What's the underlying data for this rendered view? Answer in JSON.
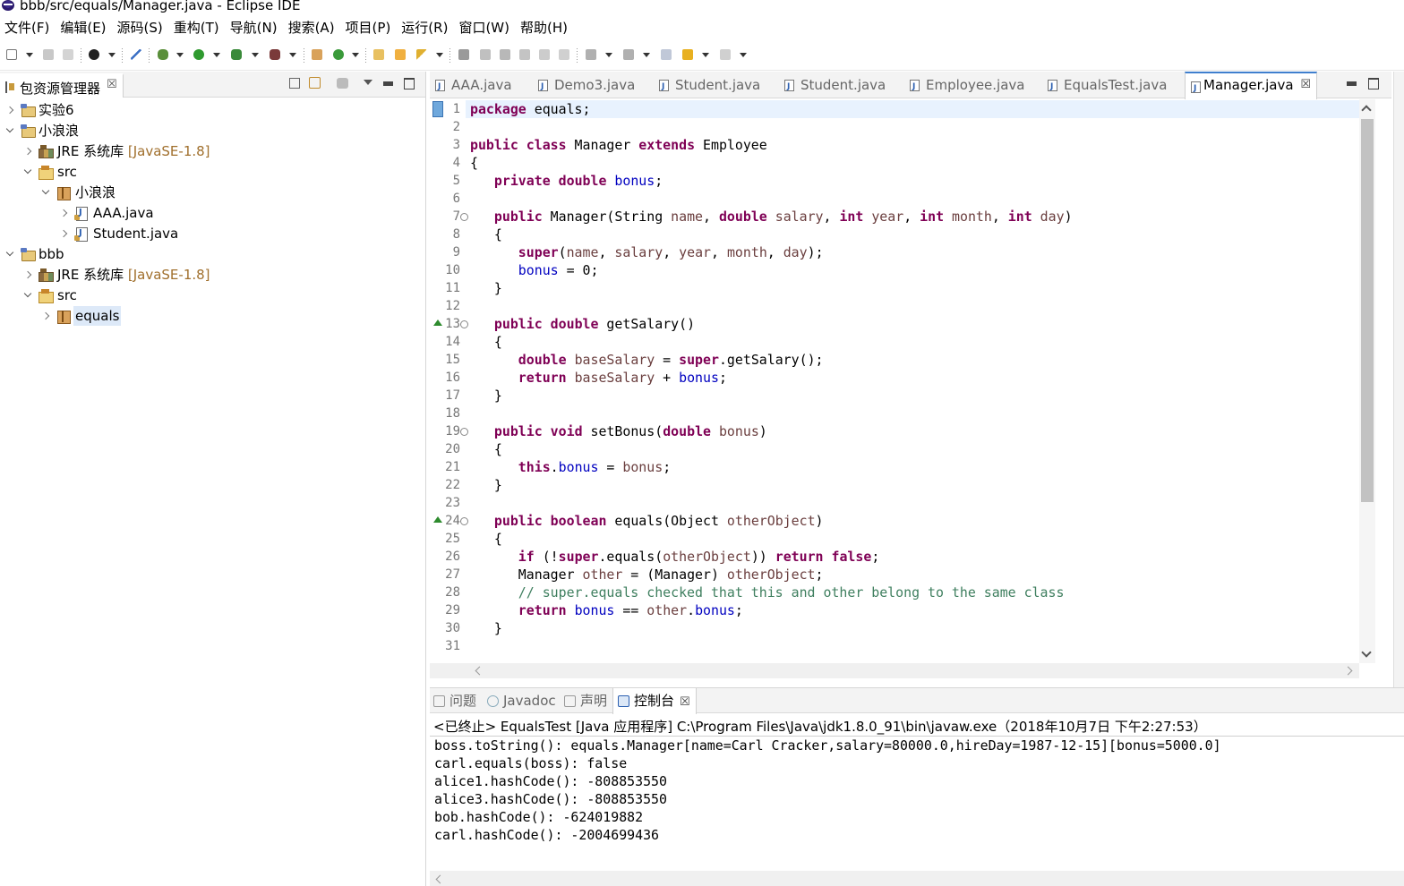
{
  "window": {
    "title": "bbb/src/equals/Manager.java - Eclipse IDE"
  },
  "menu": [
    "文件(F)",
    "编辑(E)",
    "源码(S)",
    "重构(T)",
    "导航(N)",
    "搜索(A)",
    "项目(P)",
    "运行(R)",
    "窗口(W)",
    "帮助(H)"
  ],
  "package_explorer": {
    "tab_label": "包资源管理器",
    "tree": [
      {
        "label": "实验6",
        "deco": ""
      },
      {
        "label": "小浪浪",
        "deco": ""
      },
      {
        "label": "JRE 系统库",
        "deco": "[JavaSE-1.8]"
      },
      {
        "label": "src",
        "deco": ""
      },
      {
        "label": "小浪浪",
        "deco": ""
      },
      {
        "label": "AAA.java",
        "deco": ""
      },
      {
        "label": "Student.java",
        "deco": ""
      },
      {
        "label": "bbb",
        "deco": ""
      },
      {
        "label": "JRE 系统库",
        "deco": "[JavaSE-1.8]"
      },
      {
        "label": "src",
        "deco": ""
      },
      {
        "label": "equals",
        "deco": ""
      }
    ]
  },
  "editor": {
    "tabs": [
      "AAA.java",
      "Demo3.java",
      "Student.java",
      "Student.java",
      "Employee.java",
      "EqualsTest.java",
      "Manager.java"
    ],
    "active_tab": "Manager.java",
    "lines": [
      "package equals;",
      "",
      "public class Manager extends Employee",
      "{",
      "   private double bonus;",
      "",
      "   public Manager(String name, double salary, int year, int month, int day)",
      "   {",
      "      super(name, salary, year, month, day);",
      "      bonus = 0;",
      "   }",
      "",
      "   public double getSalary()",
      "   {",
      "      double baseSalary = super.getSalary();",
      "      return baseSalary + bonus;",
      "   }",
      "",
      "   public void setBonus(double bonus)",
      "   {",
      "      this.bonus = bonus;",
      "   }",
      "",
      "   public boolean equals(Object otherObject)",
      "   {",
      "      if (!super.equals(otherObject)) return false;",
      "      Manager other = (Manager) otherObject;",
      "      // super.equals checked that this and other belong to the same class",
      "      return bonus == other.bonus;",
      "   }",
      ""
    ]
  },
  "bottom_panel": {
    "tabs": [
      "问题",
      "Javadoc",
      "声明",
      "控制台"
    ],
    "active_tab": "控制台",
    "console_header": "<已终止> EqualsTest [Java 应用程序] C:\\Program Files\\Java\\jdk1.8.0_91\\bin\\javaw.exe（2018年10月7日 下午2:27:53）",
    "output": [
      "boss.toString(): equals.Manager[name=Carl Cracker,salary=80000.0,hireDay=1987-12-15][bonus=5000.0]",
      "carl.equals(boss): false",
      "alice1.hashCode(): -808853550",
      "alice3.hashCode(): -808853550",
      "bob.hashCode(): -624019882",
      "carl.hashCode(): -2004699436"
    ]
  },
  "colors": {
    "keyword": "#7f0055",
    "field": "#0000c0",
    "variable": "#6a3e3e",
    "comment": "#3f7f5f",
    "accent": "#3f7fce"
  }
}
